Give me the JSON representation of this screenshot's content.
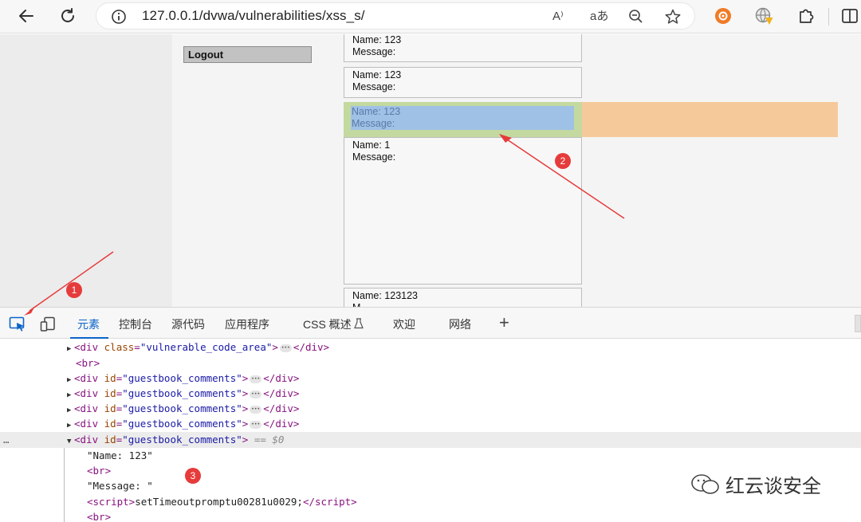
{
  "browser": {
    "url": "127.0.0.1/dvwa/vulnerabilities/xss_s/",
    "read_aloud_glyph": "A⁾",
    "translate_glyph": "aあ"
  },
  "page": {
    "logout_label": "Logout",
    "comments": [
      {
        "name": "Name: 123",
        "message": "Message:"
      },
      {
        "name": "Name: 123",
        "message": "Message:"
      },
      {
        "name": "Name: 123",
        "message": "Message:"
      },
      {
        "name": "Name: 1",
        "message": "Message:"
      },
      {
        "name": "Name: 123123",
        "message": "M"
      }
    ]
  },
  "annotations": {
    "badge1": "1",
    "badge2": "2",
    "badge3": "3"
  },
  "devtools": {
    "tabs": [
      "元素",
      "控制台",
      "源代码",
      "应用程序",
      "CSS 概述",
      "欢迎",
      "网络"
    ],
    "active_tab": "元素",
    "more_tabs": "+",
    "dom_lines": {
      "l1_attr": "class",
      "l1_val": "\"vulnerable_code_area\"",
      "br": "<br>",
      "gb_attr": "id",
      "gb_val": "\"guestbook_comments\"",
      "sel_marker": "== $0",
      "text_name": "\"Name: 123\"",
      "text_message": "\"Message: \"",
      "script_body": "setTimeoutpromptu00281u0029;",
      "row_dots": "…"
    }
  },
  "watermark": {
    "text": "红云谈安全"
  },
  "colors": {
    "accent": "#0d63c9",
    "annotation_red": "#e63b3b",
    "margin_highlight": "#f6c99b",
    "content_highlight": "#9fc1e6",
    "padding_highlight": "#c3d9a0"
  }
}
